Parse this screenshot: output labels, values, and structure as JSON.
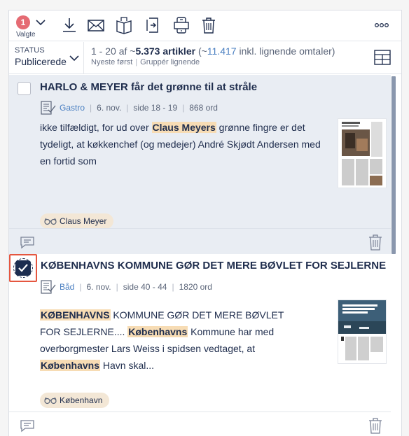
{
  "toolbar": {
    "selected_count": "1",
    "selected_label": "Valgte",
    "icons": [
      "download-icon",
      "mail-icon",
      "book-icon",
      "export-icon",
      "devices-icon",
      "trash-icon",
      "more-icon"
    ]
  },
  "status": {
    "caption": "STATUS",
    "value": "Publicerede"
  },
  "results": {
    "range": "1 - 20 af ~",
    "total": "5.373 artikler",
    "similar_prefix": " (~",
    "similar_count": "11.417",
    "similar_suffix": " inkl. lignende omtaler)",
    "sort": "Nyeste først",
    "group": "Gruppér lignende"
  },
  "articles": [
    {
      "title": "HARLO & MEYER får det grønne til at stråle",
      "source": "Gastro",
      "date": "6. nov.",
      "pages": "side 18 - 19",
      "words": "868 ord",
      "snippet_1": "ikke tilfældigt, for ud over ",
      "snippet_hl_1": "Claus Meyers",
      "snippet_2": " grønne fingre er det tydeligt, at køkkenchef (og medejer) André Skjødt Andersen med en fortid som",
      "tag": "Claus Meyer",
      "selected": false
    },
    {
      "title": "KØBENHAVNS KOMMUNE GØR DET MERE BØVLET FOR SEJLERNE",
      "source": "Båd",
      "date": "6. nov.",
      "pages": "side 40 - 44",
      "words": "1820 ord",
      "snippet_hl_1": "KØBENHAVNS",
      "snippet_2": " KOMMUNE GØR DET MERE BØVLET FOR SEJLERNE.... ",
      "snippet_hl_2": "Københavns",
      "snippet_3": " Kommune har med overborgmester Lars Weiss i spidsen vedtaget, at ",
      "snippet_hl_3": "Københavns",
      "snippet_4": " Havn skal...",
      "tag": "København",
      "selected": true
    }
  ],
  "colors": {
    "accent": "#1f2d4d",
    "badge": "#e56b73",
    "highlight": "#f7dcb4",
    "link": "#4a7fc1",
    "focus_outline": "#e5563f"
  }
}
